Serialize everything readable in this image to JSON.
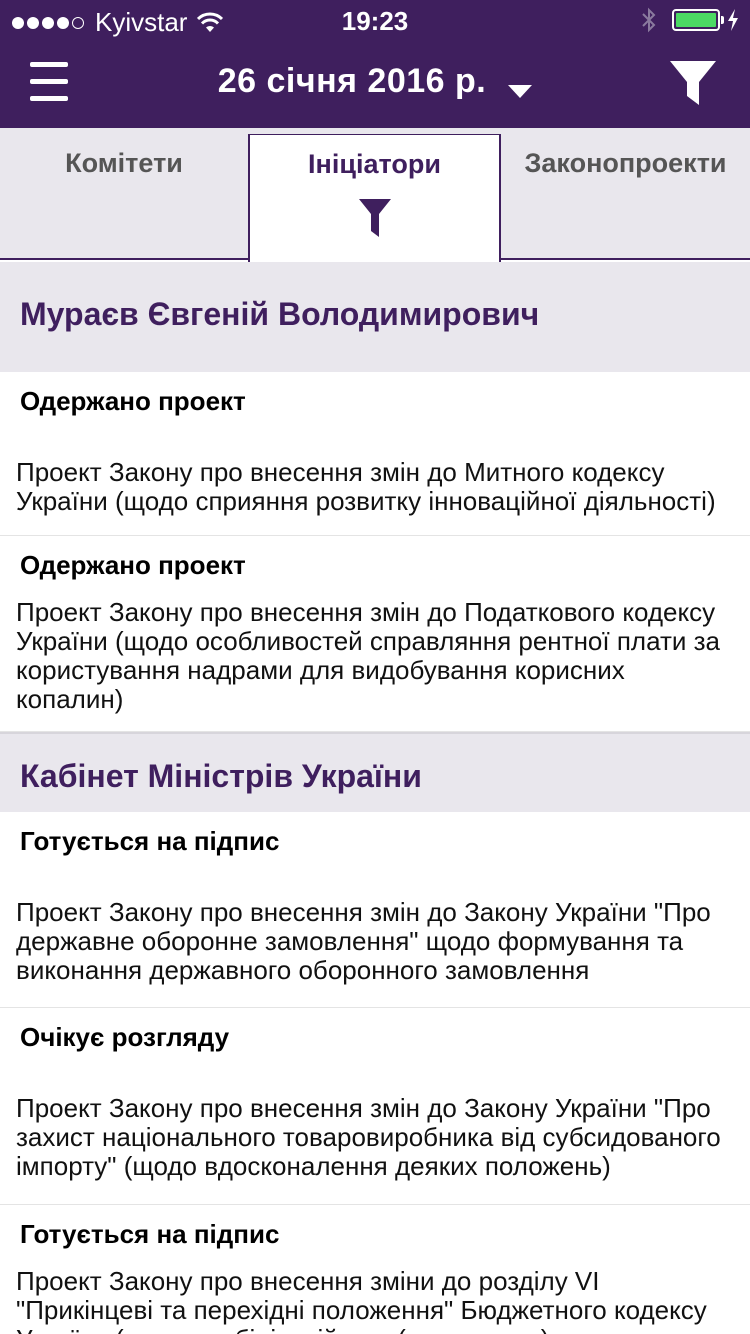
{
  "status_bar": {
    "carrier": "Kyivstar",
    "time": "19:23"
  },
  "nav": {
    "date": "26 січня 2016 р."
  },
  "tabs": [
    {
      "label": "Комітети"
    },
    {
      "label": "Ініціатори"
    },
    {
      "label": "Законопроекти"
    }
  ],
  "groups": [
    {
      "name": "Мураєв Євгеній Володимирович",
      "items": [
        {
          "status": "Одержано проект",
          "title": "Проект Закону про внесення змін до Митного кодексу України (щодо сприяння розвитку інноваційної діяльності)"
        },
        {
          "status": "Одержано проект",
          "title": "Проект Закону про внесення змін до Податкового кодексу України (щодо особливостей справляння рентної плати за користування надрами для видобування корисних копалин)"
        }
      ]
    },
    {
      "name": "Кабінет Міністрів України",
      "items": [
        {
          "status": "Готується на підпис",
          "title": "Проект Закону про внесення змін до Закону України \"Про державне оборонне замовлення\" щодо формування та виконання державного оборонного замовлення"
        },
        {
          "status": "Очікує розгляду",
          "title": "Проект Закону про внесення змін до Закону України \"Про захист національного товаровиробника від субсидованого імпорту\" (щодо вдосконалення деяких положень)"
        },
        {
          "status": "Готується на підпис",
          "title": "Проект Закону про внесення зміни до розділу VI \"Прикінцеві та перехідні положення\" Бюджетного кодексу України (щодо стабілізаційного (резервного) енергетичного"
        }
      ]
    }
  ],
  "colors": {
    "brand": "#3f1f5e",
    "battery": "#4cd964",
    "tab_bg": "#e9e7ed"
  }
}
